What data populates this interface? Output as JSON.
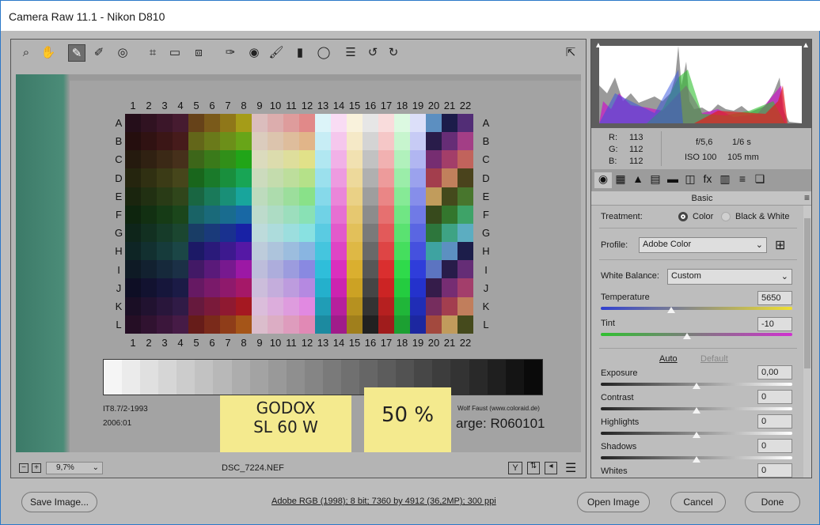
{
  "window": {
    "title": "Camera Raw 11.1  -  Nikon D810"
  },
  "toolbar": {
    "tools": [
      "zoom-icon",
      "hand-icon",
      "white-balance-icon",
      "color-sampler-icon",
      "targeted-adjustment-icon",
      "crop-icon",
      "straighten-icon",
      "transform-icon",
      "spot-removal-icon",
      "red-eye-icon",
      "adjustment-brush-icon",
      "graduated-filter-icon",
      "radial-filter-icon",
      "presets-list-icon",
      "rotate-left-icon",
      "rotate-right-icon"
    ],
    "glyphs": [
      "⌕",
      "✋",
      "✎",
      "✐",
      "◎",
      "⌗",
      "▭",
      "⧈",
      "✑",
      "◉",
      "🖌",
      "▮",
      "◯",
      "☰",
      "↺",
      "↻"
    ],
    "active_index": 2,
    "toggle_fullscreen": "⇱"
  },
  "chart": {
    "columns": [
      "1",
      "2",
      "3",
      "4",
      "5",
      "6",
      "7",
      "8",
      "9",
      "10",
      "11",
      "12",
      "13",
      "14",
      "15",
      "16",
      "17",
      "18",
      "19",
      "20",
      "21",
      "22"
    ],
    "rows": [
      "A",
      "B",
      "C",
      "D",
      "E",
      "F",
      "G",
      "H",
      "I",
      "J",
      "K",
      "L"
    ],
    "left_text_1": "IT8.7/2-1993",
    "left_text_2": "2006:01",
    "right_text_1": "Wolf Faust (www.coloraid.de)",
    "right_text_2": "arge: R060101",
    "note_1": "GODOX\nSL 60 W",
    "note_2": "50 %"
  },
  "status": {
    "zoom_value": "9,7%",
    "filename": "DSC_7224.NEF",
    "zoom_out": "−",
    "zoom_in": "+"
  },
  "info": {
    "r_label": "R:",
    "r": "113",
    "g_label": "G:",
    "g": "112",
    "b_label": "B:",
    "b": "112",
    "aperture": "f/5,6",
    "shutter": "1/6 s",
    "iso": "ISO 100",
    "focal": "105 mm"
  },
  "panel": {
    "section": "Basic",
    "tabs": [
      "◉",
      "▦",
      "▲",
      "▤",
      "▬",
      "◫",
      "fx",
      "▥",
      "≡",
      "❏"
    ],
    "treatment_label": "Treatment:",
    "treatment_color": "Color",
    "treatment_bw": "Black & White",
    "profile_label": "Profile:",
    "profile_value": "Adobe Color",
    "wb_label": "White Balance:",
    "wb_value": "Custom",
    "temperature_label": "Temperature",
    "temperature": "5650",
    "tint_label": "Tint",
    "tint": "-10",
    "auto": "Auto",
    "default": "Default",
    "sliders": [
      {
        "label": "Exposure",
        "value": "0,00"
      },
      {
        "label": "Contrast",
        "value": "0"
      },
      {
        "label": "Highlights",
        "value": "0"
      },
      {
        "label": "Shadows",
        "value": "0"
      },
      {
        "label": "Whites",
        "value": "0"
      }
    ]
  },
  "footer": {
    "save": "Save Image...",
    "workflow": "Adobe RGB (1998); 8 bit; 7360 by 4912 (36,2MP); 300 ppi",
    "open": "Open Image",
    "cancel": "Cancel",
    "done": "Done"
  }
}
